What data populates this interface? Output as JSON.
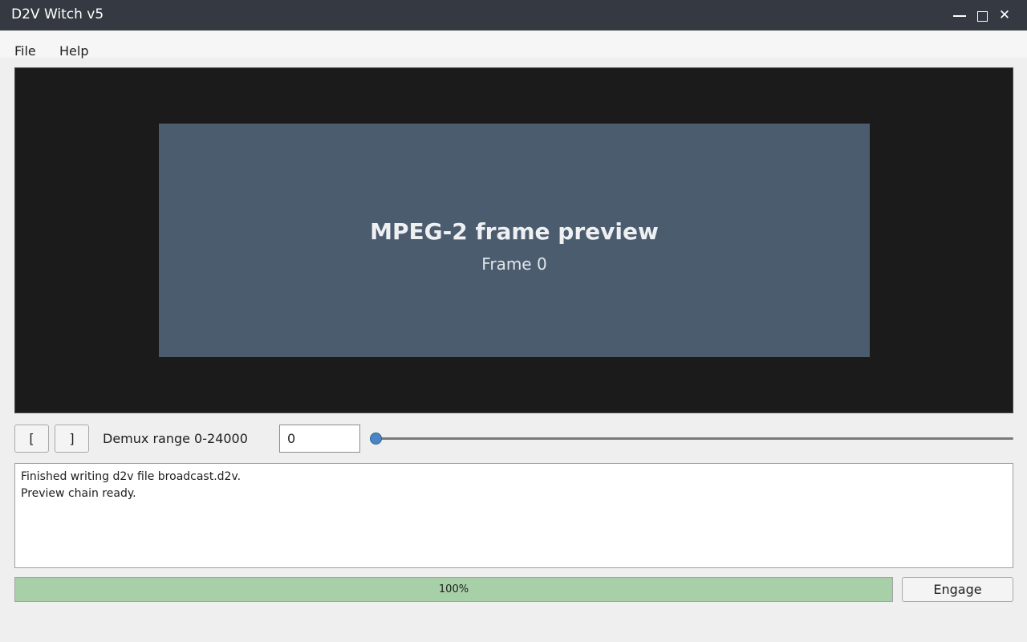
{
  "window": {
    "title": "D2V Witch v5",
    "minimize_icon": "minimize-icon",
    "maximize_icon": "maximize-icon",
    "close_icon": "close-icon",
    "close_glyph": "✕"
  },
  "menu": {
    "items": [
      {
        "label": "File"
      },
      {
        "label": "Help"
      }
    ]
  },
  "preview": {
    "title": "MPEG-2 frame preview",
    "frame_label": "Frame 0"
  },
  "controls": {
    "start_button_label": "[",
    "end_button_label": "]",
    "range_label": "Demux range 0-24000",
    "frame_value": "0",
    "slider": {
      "min": 0,
      "max": 24000,
      "value": 0
    }
  },
  "log": {
    "lines": [
      "Finished writing d2v file broadcast.d2v.",
      "Preview chain ready."
    ]
  },
  "progress": {
    "value": 100,
    "text": "100%"
  },
  "engage_label": "Engage",
  "colors": {
    "titlebar": "#353a42",
    "frame": "#4c5c6f",
    "progress_fill": "#a8d0a8",
    "slider_handle": "#4a86c5"
  }
}
